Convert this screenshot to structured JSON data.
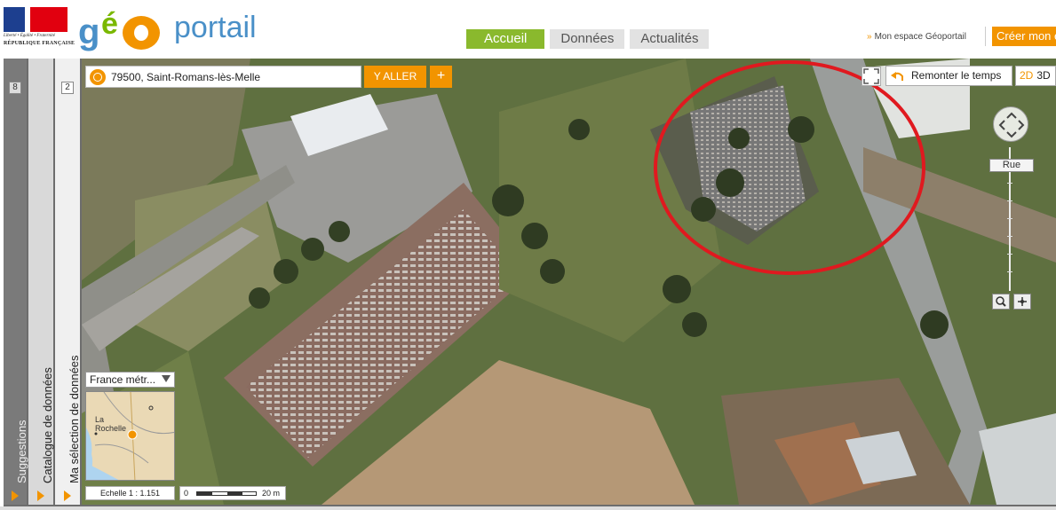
{
  "header": {
    "republic_motto": "Liberté • Égalité • Fraternité",
    "republic_name": "RÉPUBLIQUE FRANÇAISE",
    "logo": {
      "geo": "gé",
      "o": "o",
      "portail": "portail"
    },
    "nav_tabs": [
      {
        "label": "Accueil",
        "active": true
      },
      {
        "label": "Données",
        "active": false
      },
      {
        "label": "Actualités",
        "active": false
      }
    ],
    "espace_link": "Mon espace Géoportail",
    "create_button": "Créer mon e"
  },
  "side_tabs": [
    {
      "label": "Suggestions",
      "count": "8"
    },
    {
      "label": "Catalogue de données",
      "count": ""
    },
    {
      "label": "Ma sélection de données",
      "count": "2"
    }
  ],
  "map": {
    "search": {
      "value": "79500, Saint-Romans-lès-Melle",
      "placeholder": ""
    },
    "go_button": "Y ALLER",
    "plus_button": "+",
    "time_button": "Remonter le temps",
    "dim_toggle": {
      "d2": "2D",
      "d3": "3D"
    },
    "zoom_label": "Rue",
    "minimap_select": "France métr...",
    "minimap_labels": {
      "city1": "La",
      "city2": "Rochelle"
    },
    "scale_text": "Echelle 1 :  1.151",
    "scale_bar": {
      "start": "0",
      "end": "20 m"
    }
  },
  "colors": {
    "accent_orange": "#f29400",
    "nav_active": "#8ab92d",
    "annotation_red": "#e0191f"
  }
}
